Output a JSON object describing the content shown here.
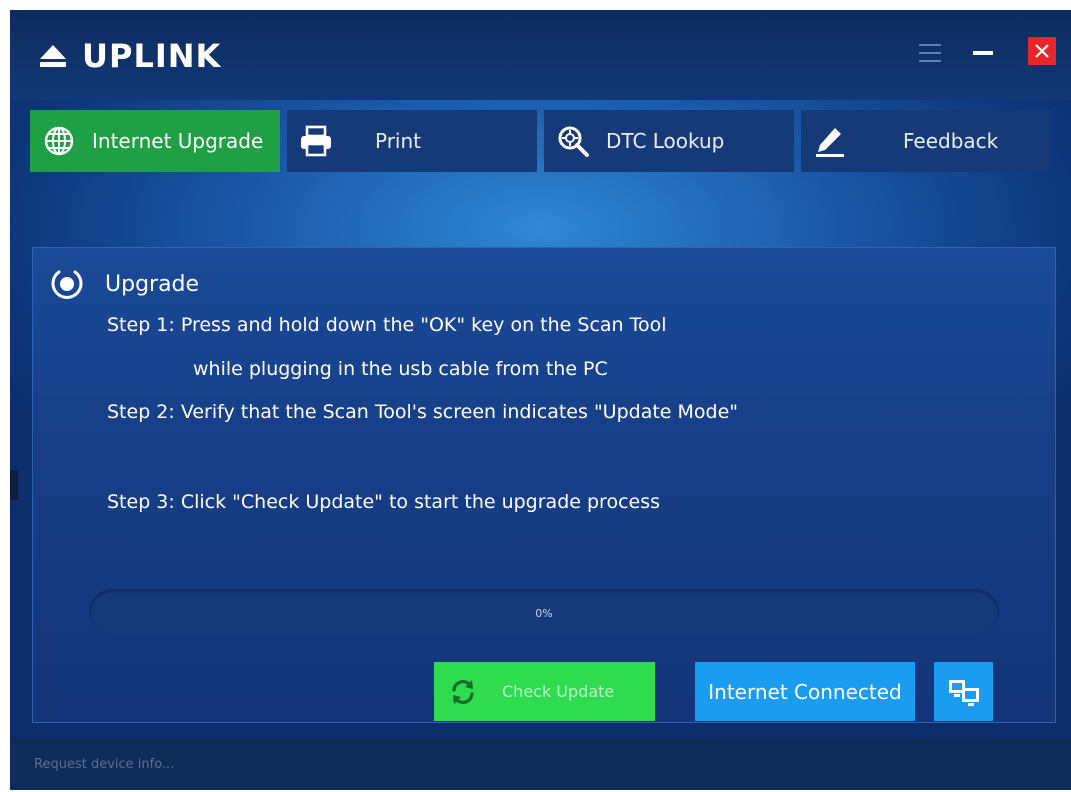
{
  "app": {
    "title": "UPLINK"
  },
  "tabs": [
    {
      "label": "Internet Upgrade",
      "icon": "globe-icon",
      "active": true
    },
    {
      "label": "Print",
      "icon": "printer-icon",
      "active": false
    },
    {
      "label": "DTC Lookup",
      "icon": "magnifier-target-icon",
      "active": false
    },
    {
      "label": "Feedback",
      "icon": "pen-icon",
      "active": false
    }
  ],
  "upgrade": {
    "title": "Upgrade",
    "step1": "Step 1: Press and hold down the \"OK\" key on the Scan Tool",
    "step1_cont": "while plugging in the usb cable from the PC",
    "step2": "Step 2: Verify that the Scan Tool's screen indicates \"Update Mode\"",
    "step3": "Step 3: Click \"Check Update\" to start the upgrade process"
  },
  "progress": {
    "label": "0%",
    "value": 0
  },
  "buttons": {
    "check_update": "Check Update",
    "internet_connected": "Internet Connected"
  },
  "status": {
    "text": "Request device info..."
  },
  "colors": {
    "active_tab": "#1fa045",
    "tab": "#163a78",
    "check_button": "#2fdc4f",
    "net_button": "#1a9cf0",
    "close_button": "#e8262a"
  }
}
